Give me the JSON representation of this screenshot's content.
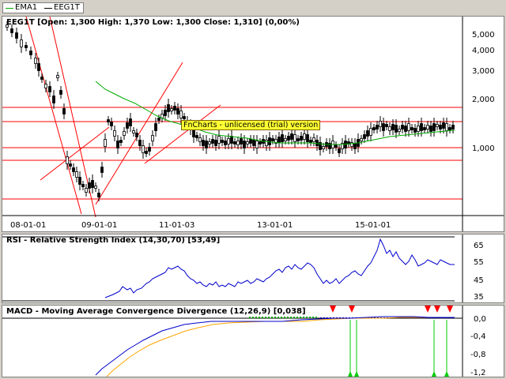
{
  "legend": {
    "items": [
      {
        "label": "EMA1",
        "color": "#00aa00"
      },
      {
        "label": "EEG1T",
        "color": "#000000"
      }
    ]
  },
  "price_panel": {
    "title": "EEG1T  [Open: 1,300  High: 1,370  Low: 1,300  Close: 1,310] (0,00%)",
    "y_ticks": [
      "5,000",
      "4,000",
      "3,000",
      "2,000",
      "1,000"
    ],
    "x_ticks": [
      "08-01-01",
      "09-01-01",
      "11-01-03",
      "13-01-01",
      "15-01-01"
    ],
    "banner": "FnCharts - unlicensed (trial) version"
  },
  "rsi_panel": {
    "title": "RSI - Relative Strength Index (14,30,70) [53,49]",
    "y_ticks": [
      "65",
      "55",
      "45",
      "35"
    ]
  },
  "macd_panel": {
    "title": "MACD - Moving Average Convergence Divergence (12,26,9) [0,038]",
    "y_ticks": [
      "0,0",
      "-0,4",
      "-0,8",
      "-1,2"
    ]
  },
  "colors": {
    "ema": "#00aa00",
    "trend_lines": "#ff0000",
    "rsi": "#0000cc",
    "macd": "#0000cc",
    "signal": "#ffa500",
    "sell_marker": "#ff0000",
    "buy_marker": "#00cc00"
  }
}
